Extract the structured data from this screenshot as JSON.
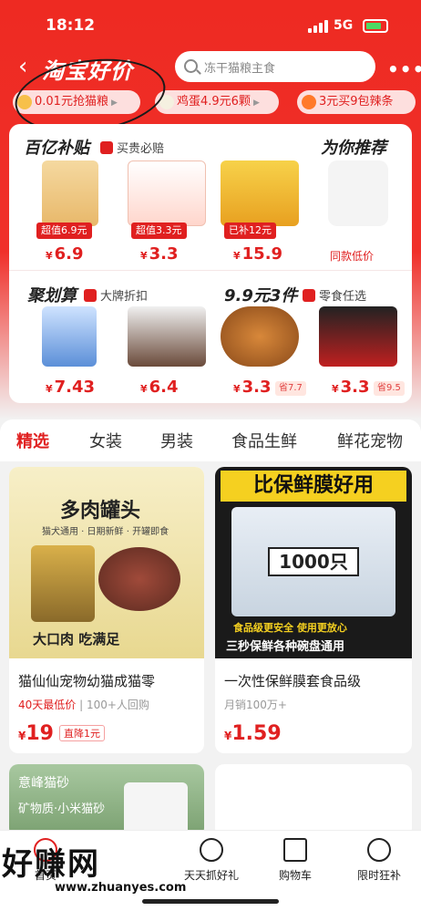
{
  "status": {
    "time": "18:12",
    "network": "5G"
  },
  "nav": {
    "brand": "淘宝好价",
    "search_placeholder": "冻干猫粮主食"
  },
  "chips": [
    {
      "label": "0.01元抢猫粮"
    },
    {
      "label": "鸡蛋4.9元6颗"
    },
    {
      "label": "3元买9包辣条"
    }
  ],
  "section1": {
    "left_title": "百亿补贴",
    "left_sub": "买贵必赔",
    "right_title": "为你推荐",
    "products": [
      {
        "badge": "超值6.9元",
        "price": "6.9"
      },
      {
        "badge": "超值3.3元",
        "price": "3.3"
      },
      {
        "badge": "已补12元",
        "price": "15.9"
      },
      {
        "note": "同款低价"
      }
    ]
  },
  "section2": {
    "left_title": "聚划算",
    "left_sub": "大牌折扣",
    "right_title": "9.9元3件",
    "right_sub": "零食任选",
    "products": [
      {
        "price": "7.43"
      },
      {
        "price": "6.4"
      },
      {
        "price": "3.3",
        "save": "省7.7"
      },
      {
        "price": "3.3",
        "save": "省9.5"
      }
    ]
  },
  "tabs": [
    "精选",
    "女装",
    "男装",
    "食品生鲜",
    "鲜花宠物"
  ],
  "feed": [
    {
      "banner_title": "多肉罐头",
      "banner_sub": "猫犬通用 · 日期新鲜 · 开罐即食",
      "banner_foot": "大口肉 吃满足",
      "title": "猫仙仙宠物幼猫成猫零",
      "meta_red": "40天最低价",
      "meta": "100+人回购",
      "price": "19",
      "drop": "直降1元"
    },
    {
      "banner_title": "比保鲜膜好用",
      "banner_mid": "1000只",
      "banner_foot1": "食品级更安全 使用更放心",
      "banner_foot2": "三秒保鲜各种碗盘通用",
      "title": "一次性保鲜膜套食品级",
      "meta": "月销100万+",
      "price": "1.59"
    },
    {
      "banner_title": "意峰猫砂",
      "banner_sub": "矿物质·小米猫砂"
    }
  ],
  "bottom_nav": [
    "首页",
    "天天抓好礼",
    "购物车",
    "限时狂补"
  ],
  "watermark": {
    "text": "好赚网",
    "url": "www.zhuanyes.com"
  },
  "currency": "¥"
}
